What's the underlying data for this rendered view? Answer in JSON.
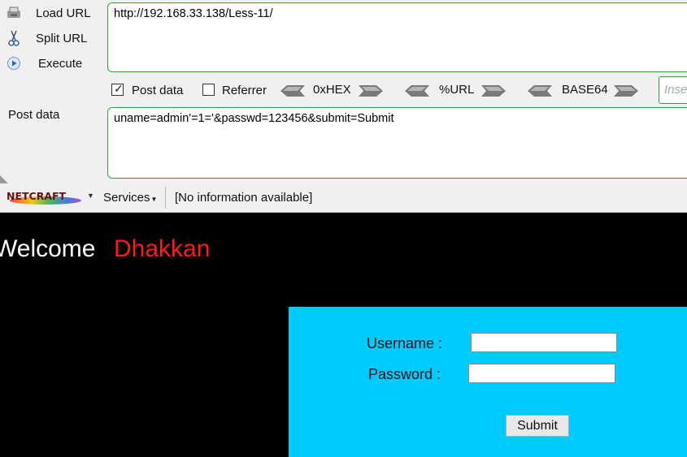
{
  "hackbar": {
    "load_url": "Load URL",
    "split_url": "Split URL",
    "execute": "Execute",
    "url_value": "http://192.168.33.138/Less-11/",
    "post_data_checkbox": "Post data",
    "post_data_checked": true,
    "referrer_checkbox": "Referrer",
    "referrer_checked": false,
    "encodings": [
      "0xHEX",
      "%URL",
      "BASE64"
    ],
    "insert_placeholder": "Insert string to replace",
    "post_label": "Post data",
    "post_value": "uname=admin'=1='&passwd=123456&submit=Submit"
  },
  "netcraft": {
    "logo_text": "NETCRAFT",
    "services": "Services",
    "info": "[No information available]"
  },
  "page": {
    "welcome": "Welcome",
    "name": "Dhakkan",
    "username_label": "Username :",
    "password_label": "Password :",
    "username_value": "",
    "password_value": "",
    "submit_label": "Submit"
  },
  "colors": {
    "accent_border": "#3c9b3c",
    "form_bg": "#00cbff",
    "name_red": "#ff1a1a",
    "page_bg": "#000000"
  }
}
